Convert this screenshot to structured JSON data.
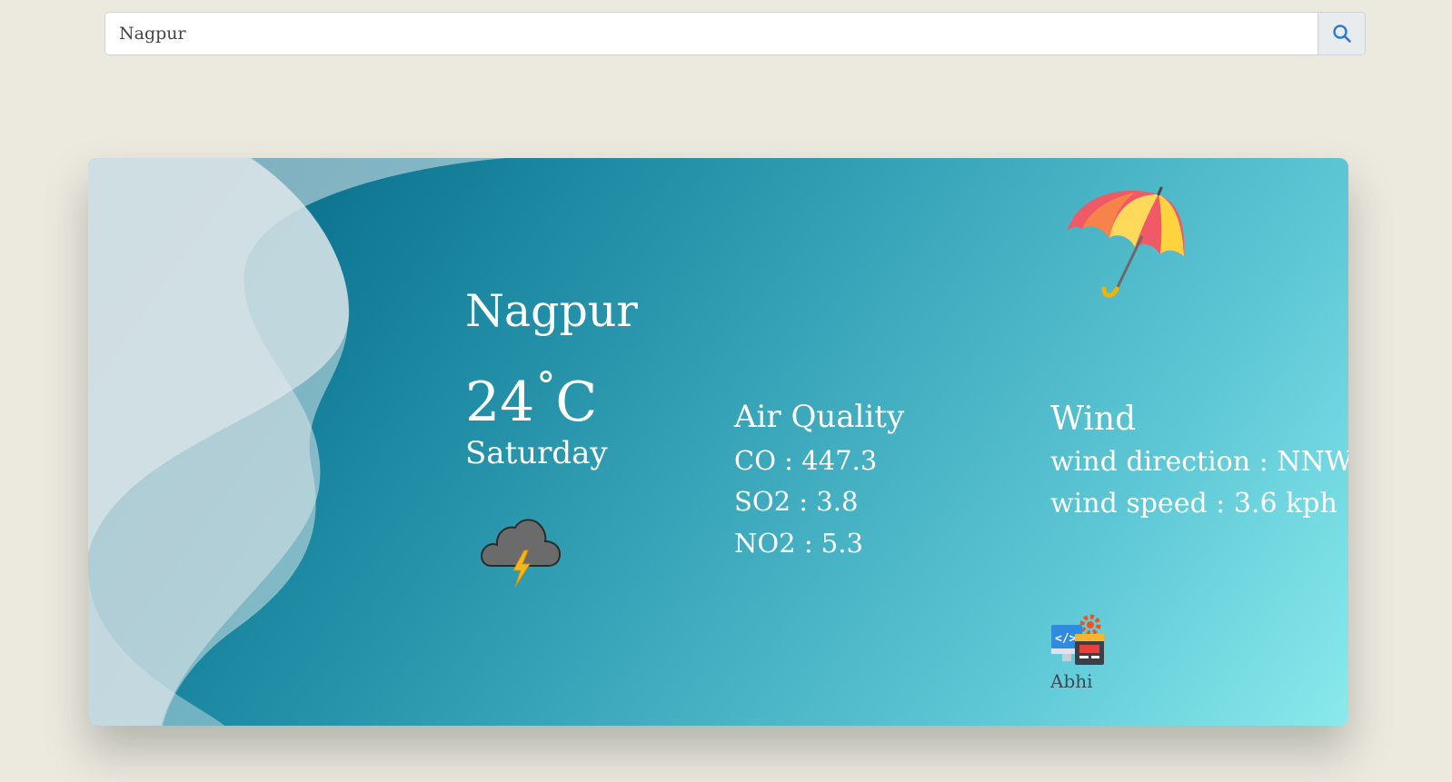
{
  "search": {
    "value": "Nagpur",
    "button_icon": "search-icon"
  },
  "weather": {
    "city": "Nagpur",
    "temperature": "24",
    "degree_symbol": "°",
    "unit": "C",
    "day": "Saturday",
    "condition_icon": "thunderstorm-cloud-icon",
    "decor_icon": "umbrella-icon"
  },
  "air_quality": {
    "title": "Air Quality",
    "co": "CO : 447.3",
    "so2": "SO2 : 3.8",
    "no2": "NO2 : 5.3"
  },
  "wind": {
    "title": "Wind",
    "direction": "wind direction : NNW",
    "speed": "wind speed : 3.6 kph"
  },
  "footer": {
    "author": "Abhi",
    "author_icon": "developer-icon"
  },
  "colors": {
    "background": "#ece9df",
    "card_gradient_start": "#00607f",
    "card_gradient_end": "#8aeaec",
    "text": "#ffffff",
    "accent": "#2a7bd4"
  }
}
